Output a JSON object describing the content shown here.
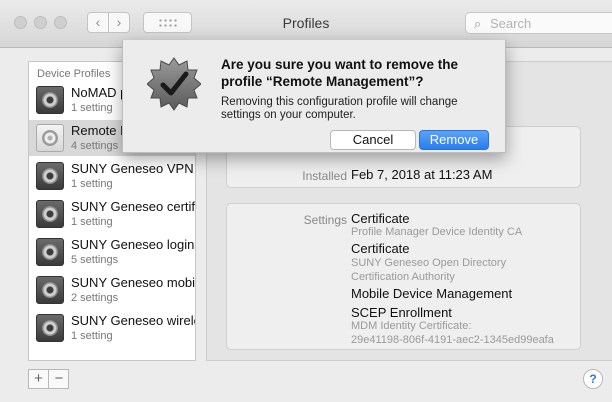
{
  "window": {
    "title": "Profiles",
    "search_placeholder": "Search"
  },
  "sidebar": {
    "header": "Device Profiles",
    "items": [
      {
        "name": "NoMAD pr",
        "sub": "1 setting",
        "selected": false
      },
      {
        "name": "Remote M",
        "sub": "4 settings",
        "selected": true
      },
      {
        "name": "SUNY Geneseo VPN set",
        "sub": "1 setting",
        "selected": false
      },
      {
        "name": "SUNY Geneseo certifica",
        "sub": "1 setting",
        "selected": false
      },
      {
        "name": "SUNY Geneseo login wir",
        "sub": "5 settings",
        "selected": false
      },
      {
        "name": "SUNY Geneseo mobility",
        "sub": "2 settings",
        "selected": false
      },
      {
        "name": "SUNY Geneseo wireless",
        "sub": "1 setting",
        "selected": false
      }
    ]
  },
  "detail": {
    "installed_label": "Installed",
    "installed_value": "Feb 7, 2018 at 11:23 AM",
    "settings_label": "Settings",
    "settings": [
      {
        "title": "Certificate",
        "lines": [
          "Profile Manager Device Identity CA"
        ]
      },
      {
        "title": "Certificate",
        "lines": [
          "SUNY Geneseo Open Directory",
          "Certification Authority"
        ]
      },
      {
        "title": "Mobile Device Management",
        "lines": []
      },
      {
        "title": "SCEP Enrollment",
        "lines": [
          "MDM Identity Certificate:",
          "29e41198-806f-4191-aec2-1345ed99eafa"
        ]
      }
    ]
  },
  "footer": {
    "add_label": "+",
    "remove_label": "−",
    "help_label": "?"
  },
  "dialog": {
    "title": "Are you sure you want to remove the profile “Remote Management”?",
    "message": "Removing this configuration profile will change settings on your computer.",
    "cancel_label": "Cancel",
    "remove_label": "Remove"
  },
  "colors": {
    "accent": "#2a7df0",
    "selection": "#d8d8d8"
  }
}
